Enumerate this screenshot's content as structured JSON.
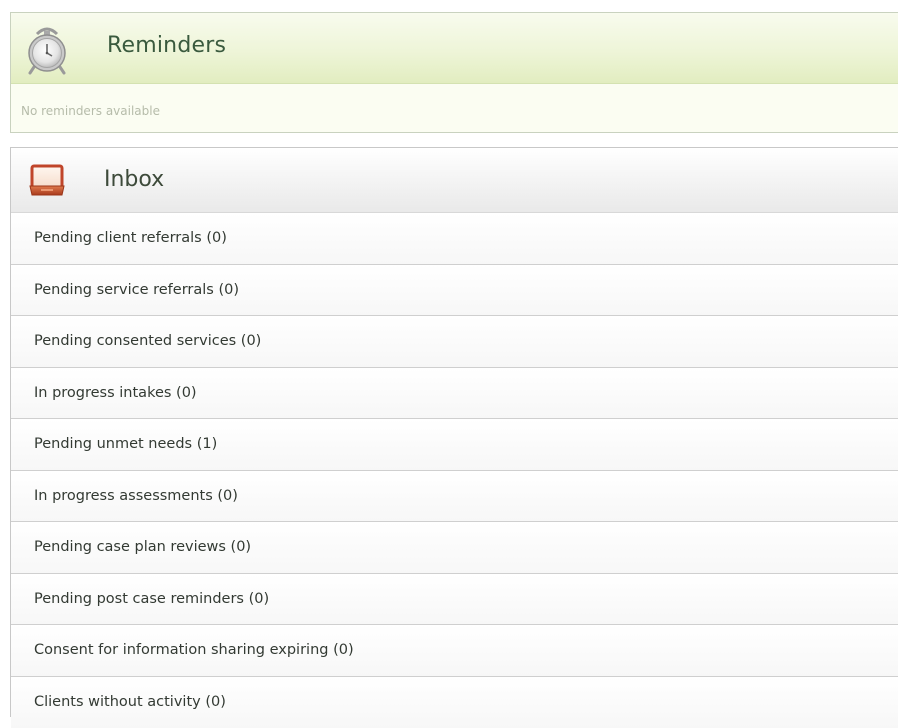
{
  "reminders": {
    "title": "Reminders",
    "empty_text": "No reminders available",
    "icon": "alarm-clock-icon"
  },
  "inbox": {
    "title": "Inbox",
    "icon": "inbox-tray-icon",
    "items": [
      {
        "label": "Pending client referrals (0)"
      },
      {
        "label": "Pending service referrals (0)"
      },
      {
        "label": "Pending consented services (0)"
      },
      {
        "label": "In progress intakes (0)"
      },
      {
        "label": "Pending unmet needs (1)"
      },
      {
        "label": "In progress assessments (0)"
      },
      {
        "label": "Pending case plan reviews (0)"
      },
      {
        "label": "Pending post case reminders (0)"
      },
      {
        "label": "Consent for information sharing expiring (0)"
      },
      {
        "label": "Clients without activity (0)"
      }
    ]
  },
  "colors": {
    "reminders_header": "#eef5d8",
    "reminders_title": "#3a5a3e",
    "inbox_icon": "#c0452a",
    "item_text": "#333a33"
  }
}
